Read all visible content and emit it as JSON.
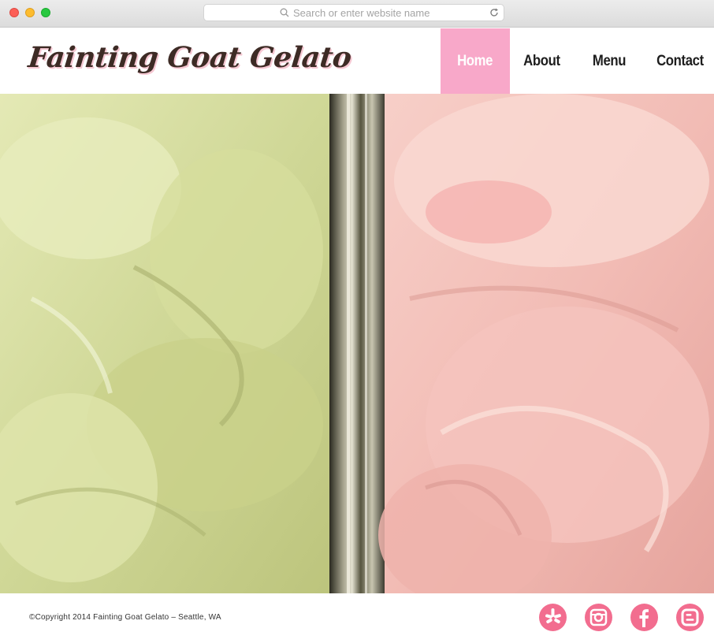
{
  "browser": {
    "address_placeholder": "Search or enter website name"
  },
  "site": {
    "logo_text": "Fainting Goat Gelato",
    "nav": [
      {
        "label": "Home",
        "active": true
      },
      {
        "label": "About",
        "active": false
      },
      {
        "label": "Menu",
        "active": false
      },
      {
        "label": "Contact",
        "active": false
      }
    ],
    "accent_color": "#f8a8c9",
    "social_color": "#f26d8f"
  },
  "hero": {
    "left_flavor_color": "#d9e0a3",
    "right_flavor_color": "#f4c5c0"
  },
  "footer": {
    "copyright": "©Copyright 2014 Fainting Goat Gelato – Seattle, WA",
    "social_icons": [
      "yelp-icon",
      "instagram-icon",
      "facebook-icon",
      "blogger-icon"
    ]
  }
}
